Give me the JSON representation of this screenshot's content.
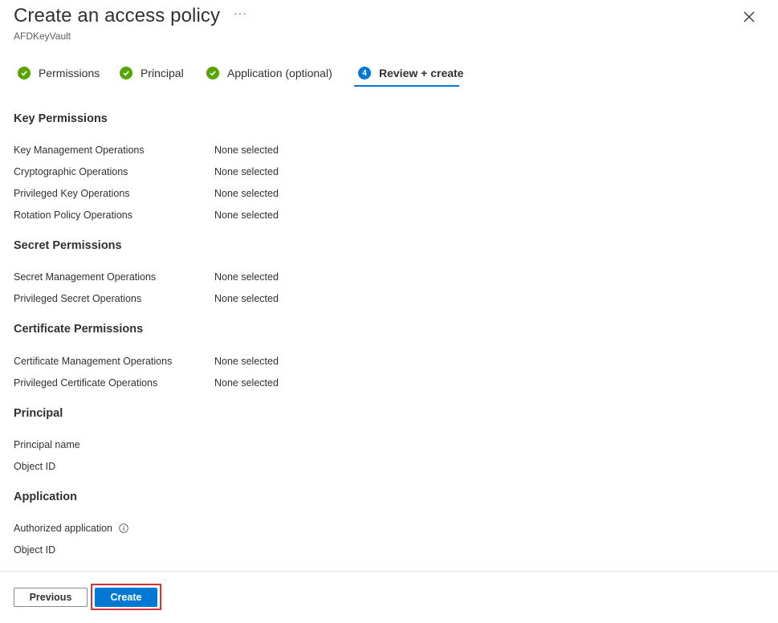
{
  "header": {
    "title": "Create an access policy",
    "more": "···",
    "subtitle": "AFDKeyVault"
  },
  "tabs": [
    {
      "label": "Permissions",
      "state": "complete"
    },
    {
      "label": "Principal",
      "state": "complete"
    },
    {
      "label": "Application (optional)",
      "state": "complete"
    },
    {
      "label": "Review + create",
      "state": "active",
      "number": "4"
    }
  ],
  "key_permissions": {
    "title": "Key Permissions",
    "rows": [
      {
        "label": "Key Management Operations",
        "value": "None selected"
      },
      {
        "label": "Cryptographic Operations",
        "value": "None selected"
      },
      {
        "label": "Privileged Key Operations",
        "value": "None selected"
      },
      {
        "label": "Rotation Policy Operations",
        "value": "None selected"
      }
    ]
  },
  "secret_permissions": {
    "title": "Secret Permissions",
    "rows": [
      {
        "label": "Secret Management Operations",
        "value": "None selected"
      },
      {
        "label": "Privileged Secret Operations",
        "value": "None selected"
      }
    ]
  },
  "certificate_permissions": {
    "title": "Certificate Permissions",
    "rows": [
      {
        "label": "Certificate Management Operations",
        "value": "None selected"
      },
      {
        "label": "Privileged Certificate Operations",
        "value": "None selected"
      }
    ]
  },
  "principal": {
    "title": "Principal",
    "rows": [
      {
        "label": "Principal name",
        "value": ""
      },
      {
        "label": "Object ID",
        "value": ""
      }
    ]
  },
  "application": {
    "title": "Application",
    "rows": [
      {
        "label": "Authorized application",
        "value": ""
      },
      {
        "label": "Object ID",
        "value": ""
      }
    ]
  },
  "footer": {
    "previous_label": "Previous",
    "create_label": "Create"
  },
  "colors": {
    "accent": "#0078d4",
    "success": "#57a300",
    "highlight": "#d13438"
  }
}
